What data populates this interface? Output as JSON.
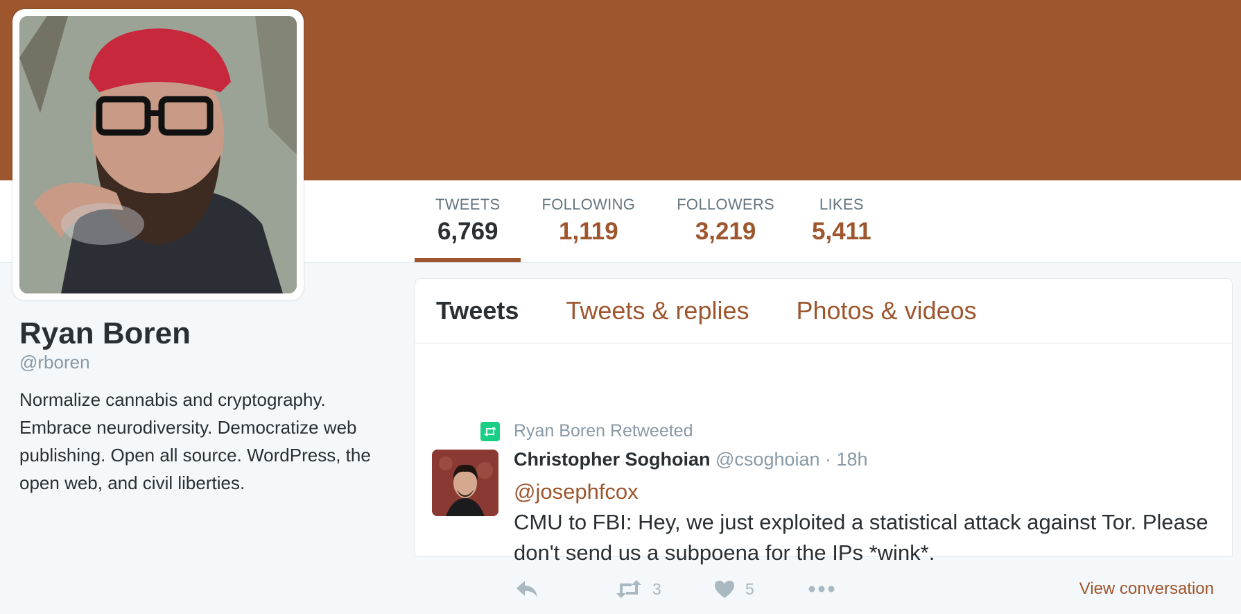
{
  "profile": {
    "name": "Ryan Boren",
    "handle": "@rboren",
    "bio": "Normalize cannabis and cryptography. Embrace neurodiversity. Democratize web publishing. Open all source. WordPress, the open web, and civil liberties."
  },
  "stats": [
    {
      "label": "TWEETS",
      "value": "6,769"
    },
    {
      "label": "FOLLOWING",
      "value": "1,119"
    },
    {
      "label": "FOLLOWERS",
      "value": "3,219"
    },
    {
      "label": "LIKES",
      "value": "5,411"
    }
  ],
  "tabs": [
    "Tweets",
    "Tweets & replies",
    "Photos & videos"
  ],
  "tweet": {
    "retweeted_by": "Ryan Boren Retweeted",
    "author_name": "Christopher Soghoian",
    "author_handle": "@csoghoian",
    "time": " · 18h",
    "mention": "@josephfcox",
    "text": "CMU to FBI: Hey, we just exploited a statistical attack against Tor. Please don't send us a subpoena for the IPs *wink*.",
    "retweet_count": "3",
    "like_count": "5",
    "view_conversation": "View conversation"
  },
  "colors": {
    "accent": "#9d562e",
    "retweet_green": "#19cf86"
  },
  "icons": [
    "reply-icon",
    "retweet-icon",
    "heart-icon",
    "more-icon"
  ]
}
